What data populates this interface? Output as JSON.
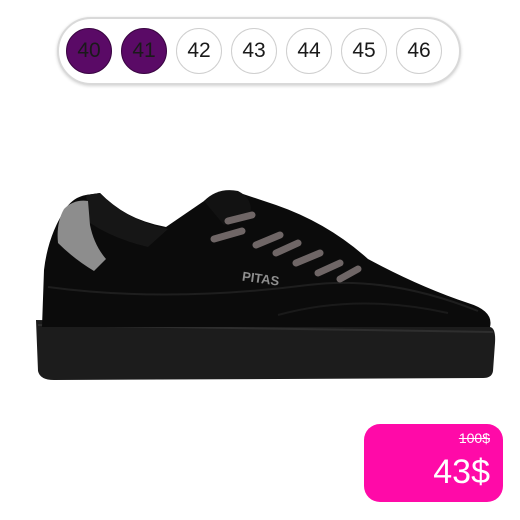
{
  "sizes": [
    {
      "label": "40",
      "selected": true
    },
    {
      "label": "41",
      "selected": true
    },
    {
      "label": "42",
      "selected": false
    },
    {
      "label": "43",
      "selected": false
    },
    {
      "label": "44",
      "selected": false
    },
    {
      "label": "45",
      "selected": false
    },
    {
      "label": "46",
      "selected": false
    }
  ],
  "product": {
    "brand_logo": "PITAS",
    "image_icon": "sneaker-illustration"
  },
  "price": {
    "old": "100$",
    "current": "43$"
  },
  "colors": {
    "selected_size": "#5a0a66",
    "price_tag": "#ff0aa8",
    "shoe_body": "#0b0b0b",
    "heel_accent": "#8d8d8d",
    "laces": "#6f6666"
  }
}
